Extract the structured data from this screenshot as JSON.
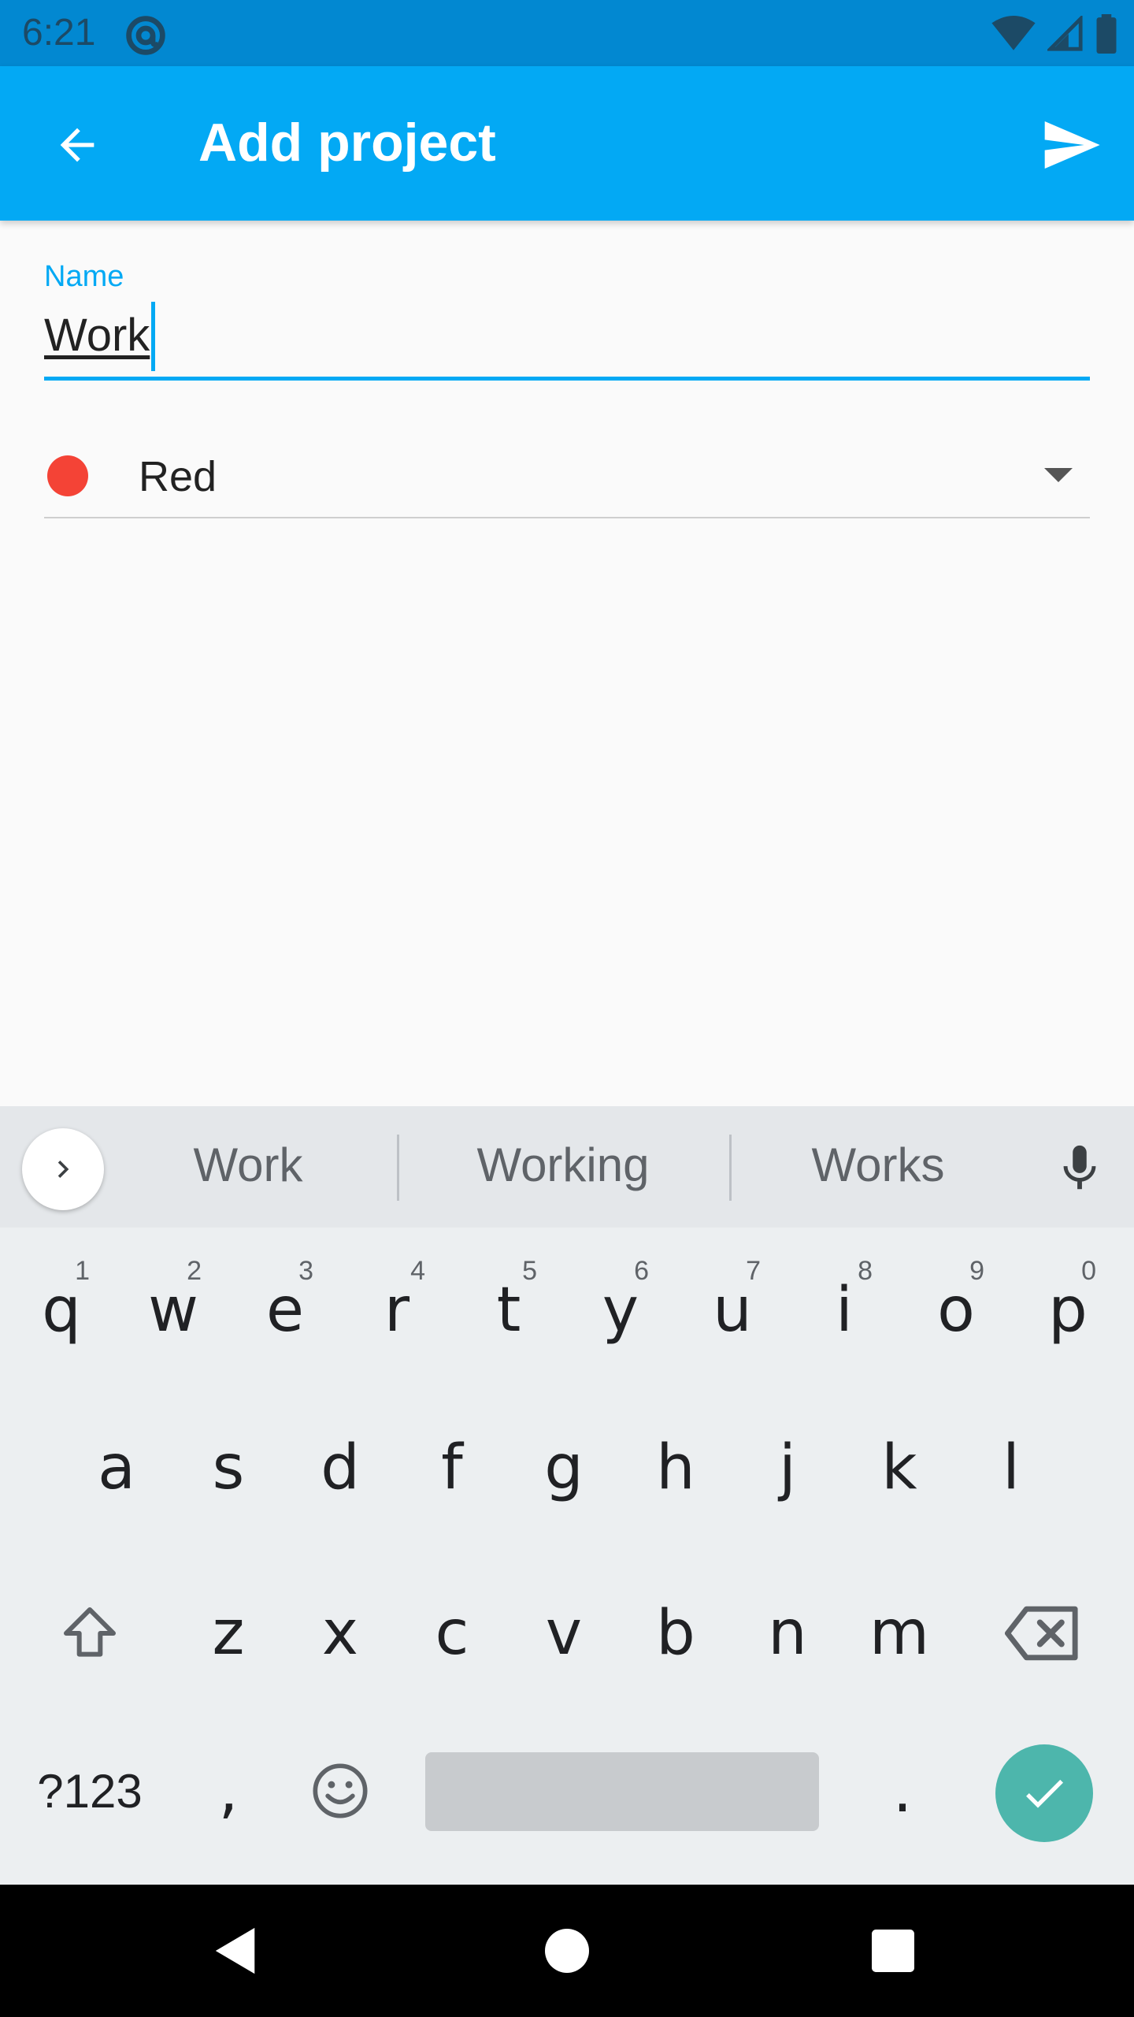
{
  "status_bar": {
    "time": "6:21"
  },
  "app_bar": {
    "title": "Add project"
  },
  "form": {
    "name_label": "Name",
    "name_value": "Work",
    "color": {
      "label": "Red",
      "swatch": "#f44336"
    }
  },
  "keyboard": {
    "suggestions": [
      "Work",
      "Working",
      "Works"
    ],
    "row1": [
      {
        "key": "q",
        "hint": "1"
      },
      {
        "key": "w",
        "hint": "2"
      },
      {
        "key": "e",
        "hint": "3"
      },
      {
        "key": "r",
        "hint": "4"
      },
      {
        "key": "t",
        "hint": "5"
      },
      {
        "key": "y",
        "hint": "6"
      },
      {
        "key": "u",
        "hint": "7"
      },
      {
        "key": "i",
        "hint": "8"
      },
      {
        "key": "o",
        "hint": "9"
      },
      {
        "key": "p",
        "hint": "0"
      }
    ],
    "row2": [
      "a",
      "s",
      "d",
      "f",
      "g",
      "h",
      "j",
      "k",
      "l"
    ],
    "row3": [
      "z",
      "x",
      "c",
      "v",
      "b",
      "n",
      "m"
    ],
    "symbols_label": "?123",
    "comma": ",",
    "period": "."
  },
  "colors": {
    "primary": "#03a9f4",
    "primary_dark": "#0288d1",
    "enter_key": "#4db6ac"
  }
}
